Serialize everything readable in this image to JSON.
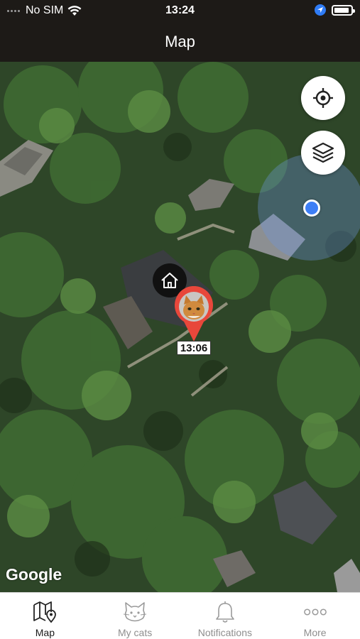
{
  "status_bar": {
    "carrier": "No SIM",
    "time": "13:24"
  },
  "nav": {
    "title": "Map"
  },
  "map": {
    "attribution": "Google",
    "cat_marker": {
      "time_label": "13:06",
      "pin_color": "#e8473b"
    },
    "user_location_color": "#3d7ef5"
  },
  "tabs": [
    {
      "label": "Map",
      "icon": "map-icon",
      "active": true
    },
    {
      "label": "My cats",
      "icon": "cat-icon",
      "active": false
    },
    {
      "label": "Notifications",
      "icon": "bell-icon",
      "active": false
    },
    {
      "label": "More",
      "icon": "more-dots-icon",
      "active": false
    }
  ]
}
